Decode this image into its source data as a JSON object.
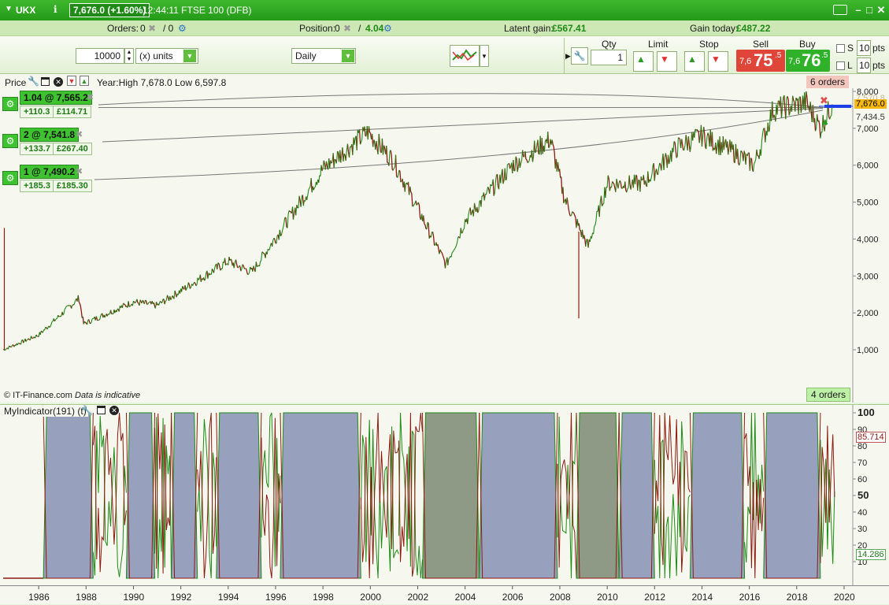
{
  "titlebar": {
    "symbol": "UKX",
    "price_change": "7,676.0 (+1.60%)",
    "time_info": "12:44:11 FTSE 100 (DFB)"
  },
  "infobar": {
    "orders_label": "Orders:",
    "orders_value": "0",
    "orders_sep": "/ 0",
    "position_label": "Position:",
    "position_value": "0",
    "position_size": "4.04",
    "latent_label": "Latent gain:",
    "latent_value": "£567.41",
    "gain_today_label": "Gain today:",
    "gain_today_value": "£487.22"
  },
  "toolbar": {
    "quantity": "10000",
    "units_select": "(x) units",
    "timeframe_select": "Daily",
    "qty_label": "Qty",
    "qty_value": "1",
    "limit_label": "Limit",
    "stop_label": "Stop",
    "sell_label": "Sell",
    "buy_label": "Buy",
    "sell_prefix": "7,6",
    "sell_big": "75",
    "sell_frac": "5",
    "buy_prefix": "7,6",
    "buy_big": "76",
    "buy_frac": "5",
    "s_label": "S",
    "l_label": "L",
    "s_pts": "10",
    "l_pts": "10",
    "pts_label": "pts"
  },
  "price_panel": {
    "title": "Price",
    "year_info": "Year:High 7,678.0 Low 6,597.8",
    "orders_top": "6 orders",
    "orders_bottom": "4 orders",
    "copyright": "© IT-Finance.com",
    "indicative": "Data is indicative",
    "positions": [
      {
        "tag": "1.04 @ 7,565.2",
        "pts": "+110.3",
        "gain": "£114.71"
      },
      {
        "tag": "2 @ 7,541.8",
        "pts": "+133.7",
        "gain": "£267.40"
      },
      {
        "tag": "1 @ 7,490.2",
        "pts": "+185.3",
        "gain": "£185.30"
      }
    ],
    "y_ticks": [
      "8,000",
      "7,000",
      "6,000",
      "5,000",
      "4,000",
      "3,000",
      "2,000",
      "1,000"
    ],
    "price_labels": {
      "current": "7,676.0",
      "ghost": "7,570.8",
      "level": "7,434.5"
    }
  },
  "indicator_panel": {
    "title": "MyIndicator(191) (t)",
    "y_ticks": [
      "100",
      "90",
      "80",
      "70",
      "60",
      "50",
      "40",
      "30",
      "20",
      "10"
    ],
    "value_high": "85.714",
    "value_low": "14.286"
  },
  "x_axis": [
    "1986",
    "1988",
    "1990",
    "1992",
    "1994",
    "1996",
    "1998",
    "2000",
    "2002",
    "2004",
    "2006",
    "2008",
    "2010",
    "2012",
    "2014",
    "2016",
    "2018",
    "2020"
  ],
  "chart_data": [
    {
      "type": "line",
      "title": "Price",
      "x": [
        1984.5,
        1986,
        1987.7,
        1987.9,
        1990,
        1991,
        1994,
        1995,
        1998,
        1999.9,
        2001,
        2003.2,
        2004,
        2006,
        2007.6,
        2008.2,
        2009.2,
        2010,
        2011.5,
        2013,
        2014,
        2015.5,
        2016.2,
        2017,
        2018.4,
        2019,
        2019.5
      ],
      "series": [
        {
          "values": [
            1000,
            1400,
            2400,
            1700,
            2300,
            2200,
            3400,
            3100,
            5900,
            6900,
            6100,
            3300,
            4500,
            6000,
            6700,
            5100,
            3800,
            5500,
            5500,
            6500,
            6800,
            6300,
            6000,
            7500,
            7700,
            7000,
            7650
          ]
        }
      ],
      "ylim": [
        0,
        8300
      ],
      "xlim": [
        1984.5,
        2020.3
      ],
      "grid": false
    },
    {
      "type": "area",
      "title": "MyIndicator(191) (t)",
      "ylim": [
        0,
        100
      ],
      "regimes": [
        {
          "from": 1984.5,
          "to": 1986.2,
          "state": "low"
        },
        {
          "from": 1986.2,
          "to": 1988.3,
          "state": "blue"
        },
        {
          "from": 1988.3,
          "to": 1989.7,
          "state": "mixed"
        },
        {
          "from": 1989.7,
          "to": 1990.9,
          "state": "blue"
        },
        {
          "from": 1990.9,
          "to": 1991.6,
          "state": "mixed"
        },
        {
          "from": 1991.6,
          "to": 1992.7,
          "state": "blue"
        },
        {
          "from": 1992.7,
          "to": 1993.5,
          "state": "mixed"
        },
        {
          "from": 1993.5,
          "to": 1995.4,
          "state": "blue"
        },
        {
          "from": 1995.4,
          "to": 1996.2,
          "state": "mixed"
        },
        {
          "from": 1996.2,
          "to": 1999.6,
          "state": "blue"
        },
        {
          "from": 1999.6,
          "to": 2001.2,
          "state": "mixed"
        },
        {
          "from": 2001.2,
          "to": 2002.2,
          "state": "mixed"
        },
        {
          "from": 2002.2,
          "to": 2004.6,
          "state": "olive"
        },
        {
          "from": 2004.6,
          "to": 2007.9,
          "state": "blue"
        },
        {
          "from": 2007.9,
          "to": 2008.7,
          "state": "mixed"
        },
        {
          "from": 2008.7,
          "to": 2010.5,
          "state": "olive"
        },
        {
          "from": 2010.5,
          "to": 2012.0,
          "state": "blue"
        },
        {
          "from": 2012.0,
          "to": 2013.5,
          "state": "mixed"
        },
        {
          "from": 2013.5,
          "to": 2015.8,
          "state": "blue"
        },
        {
          "from": 2015.8,
          "to": 2016.6,
          "state": "mixed"
        },
        {
          "from": 2016.6,
          "to": 2019.0,
          "state": "blue"
        },
        {
          "from": 2019.0,
          "to": 2019.6,
          "state": "mixed"
        }
      ]
    }
  ]
}
